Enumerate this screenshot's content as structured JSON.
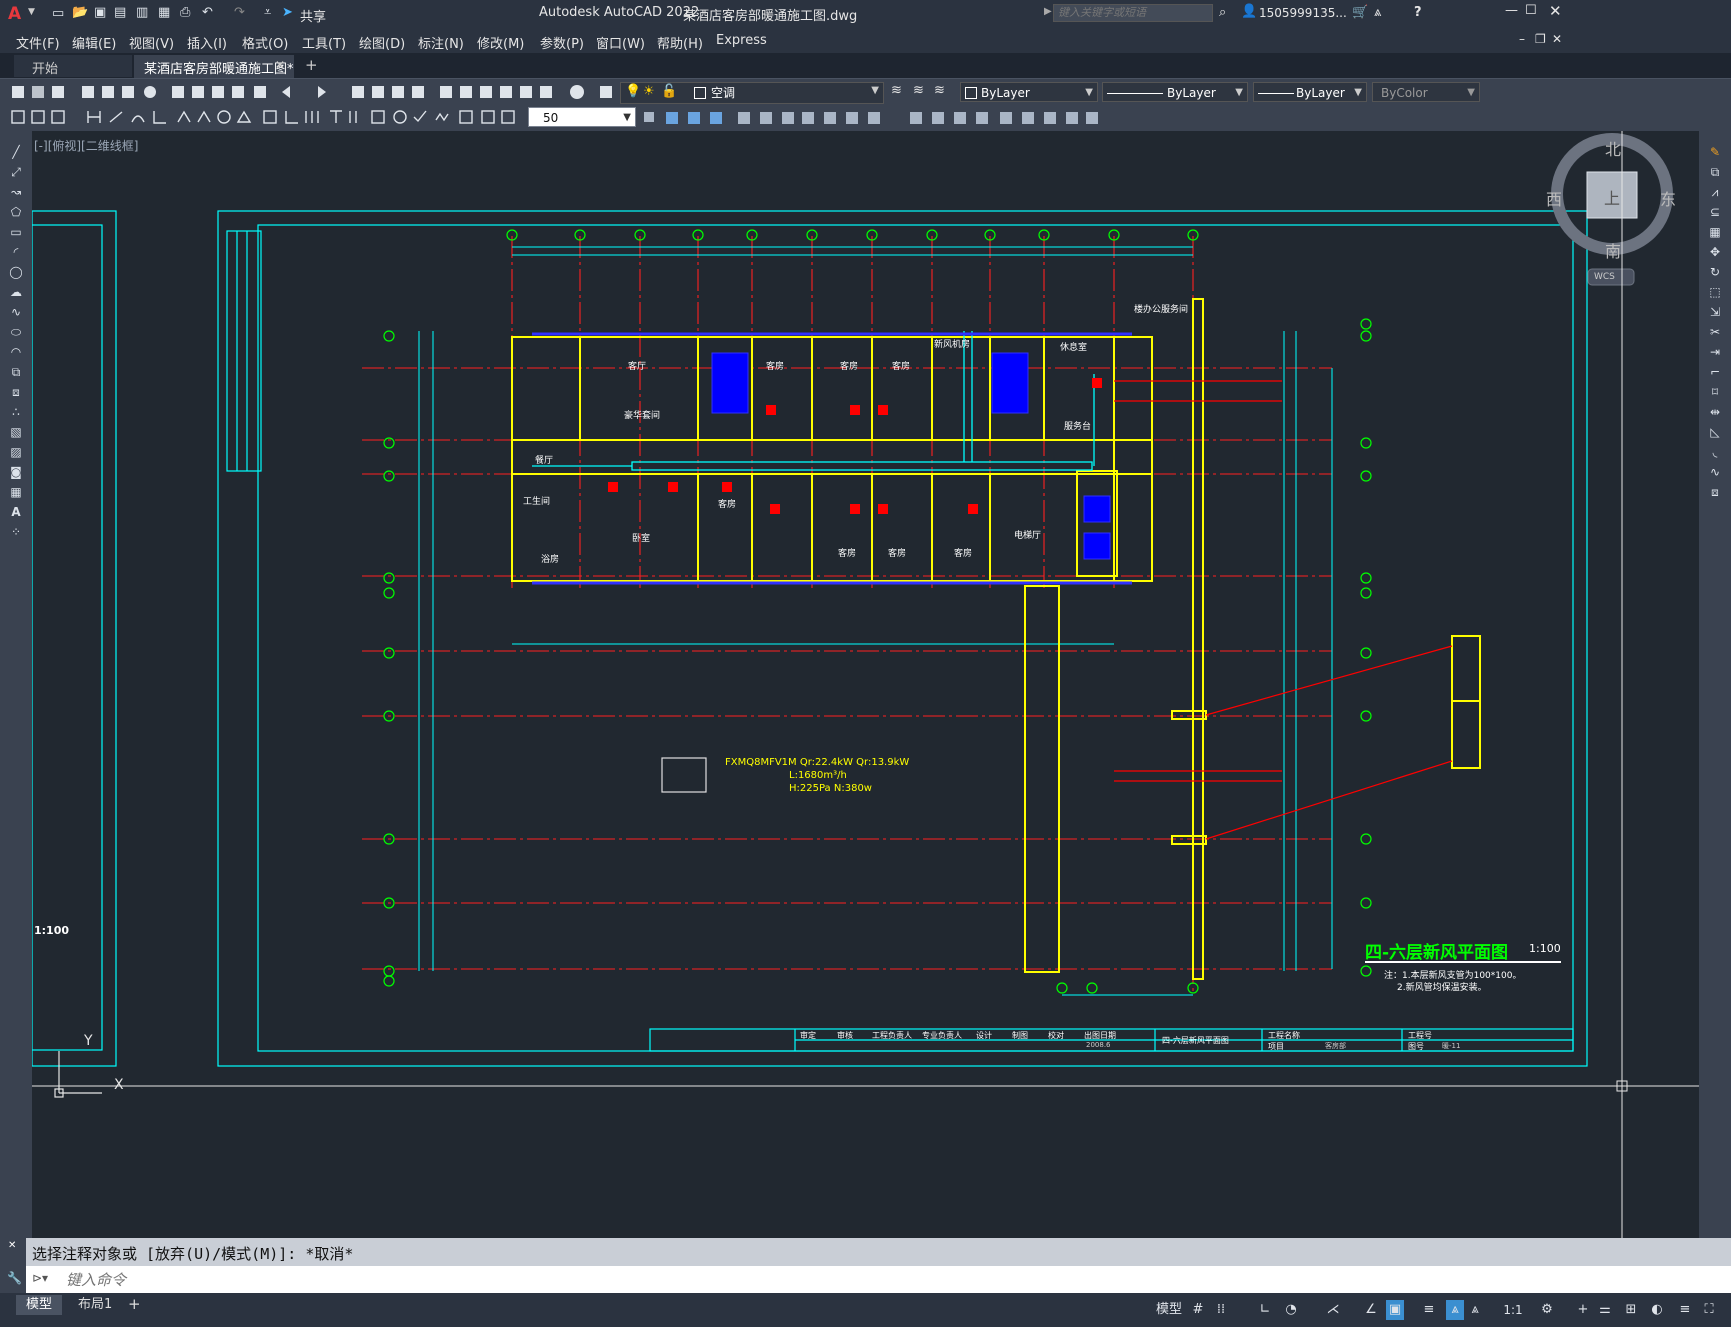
{
  "titlebar": {
    "app_title": "Autodesk AutoCAD 2022",
    "document_title": "某酒店客房部暖通施工图.dwg",
    "share_label": "共享",
    "search_placeholder": "键入关键字或短语",
    "user": "1505999135...",
    "app_icon": "autocad-logo-icon",
    "help_label": "?"
  },
  "menubar": {
    "items": [
      "文件(F)",
      "编辑(E)",
      "视图(V)",
      "插入(I)",
      "格式(O)",
      "工具(T)",
      "绘图(D)",
      "标注(N)",
      "修改(M)",
      "参数(P)",
      "窗口(W)",
      "帮助(H)",
      "Express"
    ]
  },
  "tabs": [
    {
      "label": "开始"
    },
    {
      "label": "某酒店客房部暖通施工图*",
      "active": true
    }
  ],
  "toolbar": {
    "layer_name": "空调",
    "color": "ByLayer",
    "linetype": "ByLayer",
    "lineweight": "ByLayer",
    "plotstyle": "ByColor",
    "dim_scale": "50"
  },
  "viewport": {
    "label": "[-][俯视][二维线框]",
    "compass": {
      "north": "北",
      "south": "南",
      "east": "东",
      "west": "西",
      "top": "上",
      "ucs": "WCS"
    },
    "ucs_y": "Y",
    "ucs_x": "X"
  },
  "drawing": {
    "plan_title": "四-六层新风平面图",
    "plan_scale": "1:100",
    "notes": [
      "注：1.本层新风支管为100*100。",
      "2.新风管均保温安装。"
    ],
    "left_scale": "1:100",
    "unit_label": "FXMQ8MFV1M   Qr:22.4kW  Qr:13.9kW",
    "unit_line2": "L:1680m³/h",
    "unit_line3": "H:225Pa  N:380w",
    "rooms": [
      "客厅",
      "客房",
      "客房",
      "客房",
      "楼办公服务间",
      "休息室",
      "豪华套间",
      "新风机房",
      "服务台",
      "餐厅",
      "工生间",
      "卧室",
      "浴房",
      "客房",
      "客房",
      "客房",
      "客房",
      "电梯厅"
    ],
    "titleblock": {
      "headers": [
        "审定",
        "审核",
        "工程负责人",
        "专业负责人",
        "设计",
        "制图",
        "校对",
        "出图日期"
      ],
      "date": "2008.6",
      "sheet_name": "四-六层新风平面图",
      "project_label": "工程名称",
      "item_label": "项目",
      "item_value": "客房部",
      "drawing_no_label": "工程号",
      "sheet_no_label": "图号",
      "sheet_no": "暖-11"
    }
  },
  "command": {
    "history": "选择注释对象或 [放弃(U)/模式(M)]: *取消*",
    "input_placeholder": "键入命令"
  },
  "status": {
    "layout_tabs": [
      "模型",
      "布局1"
    ],
    "model_label": "模型",
    "scale": "1:1"
  },
  "colors": {
    "accent_red": "#ff0000",
    "wall_yellow": "#ffff00",
    "duct_cyan": "#00ffff",
    "axis_green": "#00ff00",
    "duct_blue": "#0000ff"
  }
}
